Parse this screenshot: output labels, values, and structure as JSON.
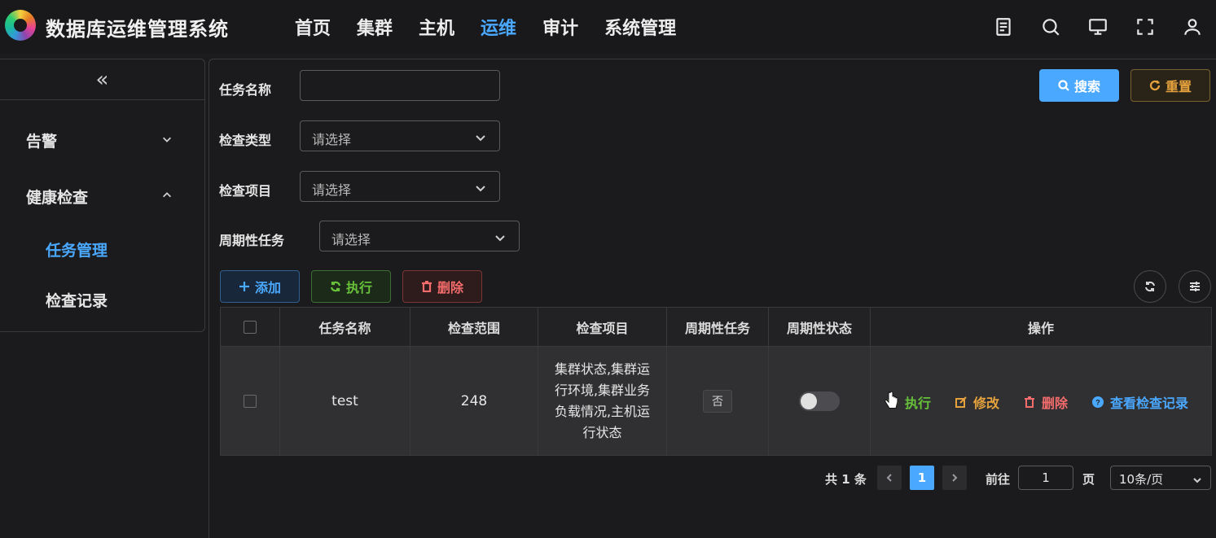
{
  "app": {
    "title": "数据库运维管理系统"
  },
  "nav": [
    "首页",
    "集群",
    "主机",
    "运维",
    "审计",
    "系统管理"
  ],
  "nav_active": "运维",
  "header_icons": [
    "document-icon",
    "search-icon",
    "monitor-icon",
    "fullscreen-icon",
    "user-icon"
  ],
  "sidebar": {
    "collapse_glyph": "«",
    "groups": [
      {
        "label": "告警",
        "expanded": false
      },
      {
        "label": "健康检查",
        "expanded": true
      }
    ],
    "sub_items": [
      {
        "label": "任务管理",
        "active": true
      },
      {
        "label": "检查记录",
        "active": false
      }
    ]
  },
  "filters": {
    "task_name_label": "任务名称",
    "task_name_value": "",
    "check_type_label": "检查类型",
    "check_type_placeholder": "请选择",
    "check_item_label": "检查项目",
    "check_item_placeholder": "请选择",
    "periodic_label": "周期性任务",
    "periodic_placeholder": "请选择",
    "search_label": "搜索",
    "reset_label": "重置"
  },
  "toolbar": {
    "add_label": "添加",
    "exec_label": "执行",
    "delete_label": "删除"
  },
  "table": {
    "columns": [
      "任务名称",
      "检查范围",
      "检查项目",
      "周期性任务",
      "周期性状态",
      "操作"
    ],
    "rows": [
      {
        "task_name": "test",
        "scope": "248",
        "items": "集群状态,集群运行环境,集群业务负载情况,主机运行状态",
        "periodic": "否",
        "periodic_status": false,
        "ops": {
          "exec": "执行",
          "edit": "修改",
          "delete": "删除",
          "view": "查看检查记录"
        }
      }
    ]
  },
  "pagination": {
    "total": "共 1 条",
    "current_page": "1",
    "goto_label": "前往",
    "goto_value": "1",
    "page_unit": "页",
    "page_size": "10条/页"
  },
  "colors": {
    "accent": "#4aa8ff",
    "success": "#67c23a",
    "warning": "#e6a23c",
    "danger": "#f56c6c",
    "background": "#1b1b1d"
  }
}
